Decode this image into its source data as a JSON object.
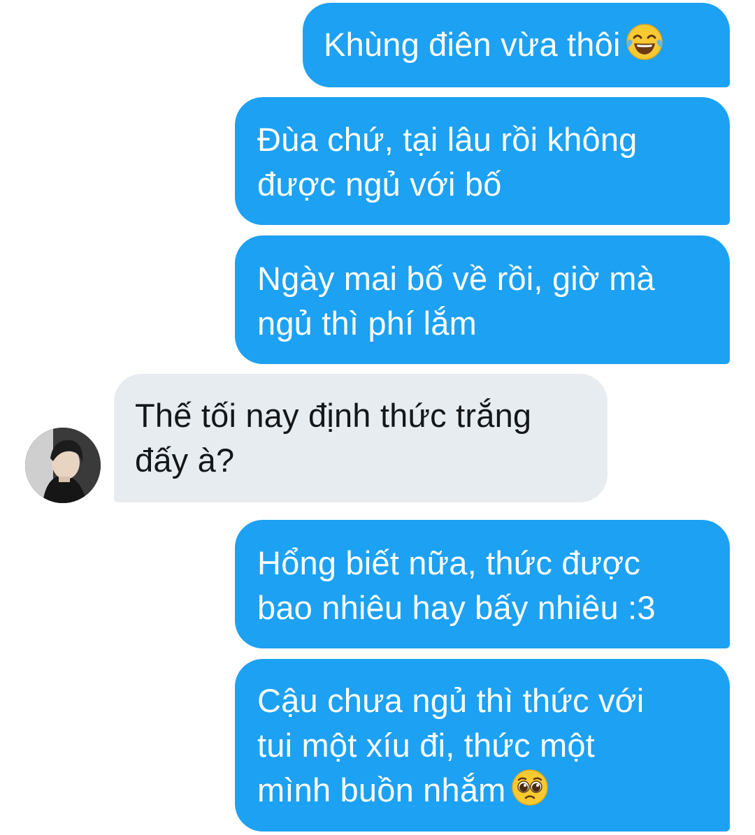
{
  "messages": [
    {
      "direction": "sent",
      "lines": [
        "Khùng điên vừa thôi"
      ],
      "emoji": "face-with-tears-of-joy-emoji"
    },
    {
      "direction": "sent",
      "lines": [
        "Đùa chứ, tại lâu rồi không",
        "được ngủ với bố"
      ]
    },
    {
      "direction": "sent",
      "lines": [
        "Ngày mai bố về rồi, giờ mà",
        "ngủ thì phí lắm"
      ]
    },
    {
      "direction": "received",
      "lines": [
        "Thế tối nay định thức trắng",
        "đấy à?"
      ],
      "avatar": "contact-avatar"
    },
    {
      "direction": "sent",
      "lines": [
        "Hổng biết nữa, thức được",
        "bao nhiêu hay bấy nhiêu :3"
      ]
    },
    {
      "direction": "sent",
      "lines": [
        "Cậu chưa ngủ thì thức với",
        "tui một xíu đi, thức một",
        "mình buồn nhắm"
      ],
      "emoji": "pleading-face-emoji"
    }
  ],
  "colors": {
    "sent_bubble": "#1da1f2",
    "received_bubble": "#e6ecf0",
    "sent_text": "#ffffff",
    "received_text": "#14171a"
  }
}
